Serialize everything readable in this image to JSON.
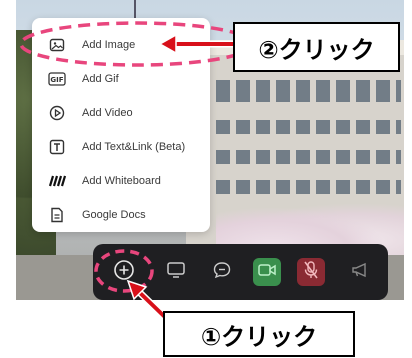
{
  "menu": {
    "items": [
      {
        "label": "Add Image",
        "icon": "image-icon"
      },
      {
        "label": "Add Gif",
        "icon": "gif-icon"
      },
      {
        "label": "Add Video",
        "icon": "play-circle-icon"
      },
      {
        "label": "Add Text&Link (Beta)",
        "icon": "text-icon"
      },
      {
        "label": "Add Whiteboard",
        "icon": "whiteboard-icon"
      },
      {
        "label": "Google Docs",
        "icon": "document-icon"
      }
    ]
  },
  "toolbar": {
    "buttons": [
      "add-icon",
      "screen-share-icon",
      "chat-icon",
      "camera-icon",
      "mic-off-icon",
      "megaphone-icon"
    ]
  },
  "annotations": {
    "step1": "①クリック",
    "step2": "②クリック"
  },
  "colors": {
    "annotation": "#e8467d",
    "arrow": "#d8101a",
    "camera_button": "#3a8f4d",
    "mic_button": "#8a2a33"
  }
}
